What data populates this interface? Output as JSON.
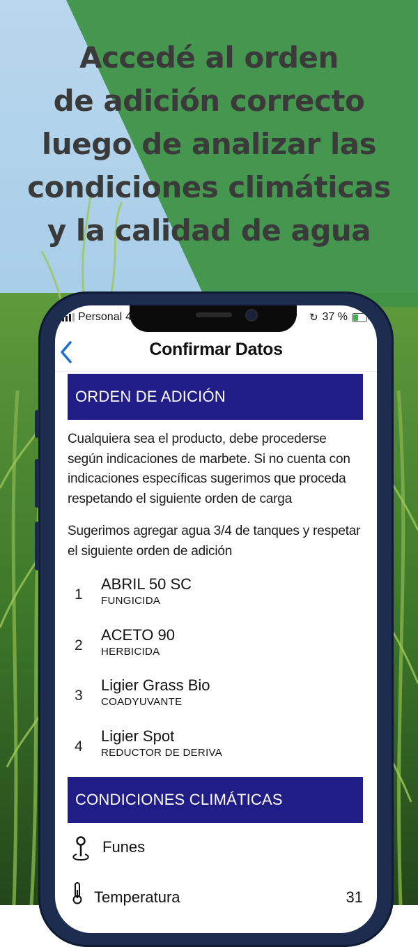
{
  "headline": {
    "lines": [
      "Accedé al orden",
      "de adición correcto",
      "luego de analizar las",
      "condiciones climáticas",
      "y la calidad de agua"
    ]
  },
  "status_bar": {
    "carrier": "Personal",
    "network": "4",
    "battery_text": "37 %",
    "battery_level": 0.37
  },
  "nav": {
    "back_icon": "chevron-left-icon",
    "title": "Confirmar Datos"
  },
  "orden": {
    "header": "ORDEN DE ADICIÓN",
    "intro": "Cualquiera sea el producto, debe procederse según indicaciones de marbete. Si no cuenta con indicaciones específicas sugerimos que proceda respetando el siguiente orden de carga",
    "suggestion": "Sugerimos agregar agua 3/4 de tanques y respetar el siguiente orden de adición",
    "items": [
      {
        "num": "1",
        "name": "ABRIL 50 SC",
        "type": "FUNGICIDA"
      },
      {
        "num": "2",
        "name": "ACETO 90",
        "type": "HERBICIDA"
      },
      {
        "num": "3",
        "name": "Ligier Grass Bio",
        "type": "COADYUVANTE"
      },
      {
        "num": "4",
        "name": "Ligier Spot",
        "type": "REDUCTOR DE DERIVA"
      }
    ]
  },
  "clima": {
    "header": "CONDICIONES CLIMÁTICAS",
    "location": "Funes",
    "location_icon": "location-pin-icon",
    "temperature_label": "Temperatura",
    "temperature_value": "31",
    "temperature_icon": "thermometer-icon"
  },
  "colors": {
    "section_bar": "#201d87",
    "accent": "#1a6fd6",
    "green_overlay": "#3f9447"
  }
}
